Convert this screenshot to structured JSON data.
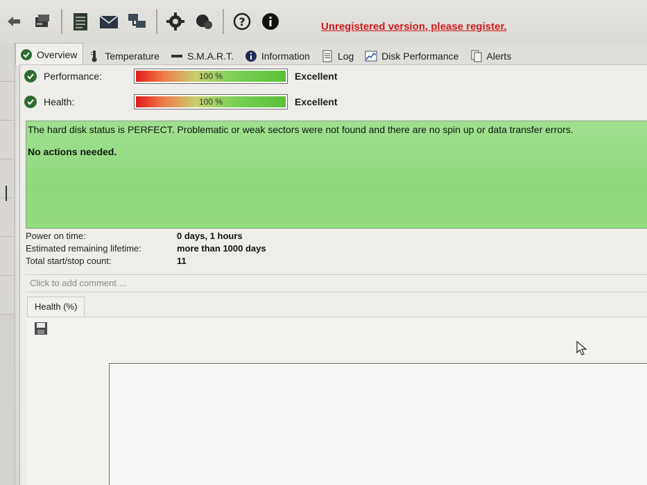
{
  "toolbar": {
    "items": [
      {
        "icon": "arrow-left-icon"
      },
      {
        "icon": "drive-icon"
      },
      {
        "icon": "notepad-icon"
      },
      {
        "icon": "email-icon"
      },
      {
        "icon": "network-icon"
      },
      {
        "icon": "settings-gear-icon"
      },
      {
        "icon": "tools-icon"
      },
      {
        "icon": "help-icon"
      },
      {
        "icon": "info-icon"
      }
    ],
    "register_link": "Unregistered version, please register."
  },
  "tabs": [
    {
      "label": "Overview",
      "icon": "check-icon",
      "active": true
    },
    {
      "label": "Temperature",
      "icon": "thermometer-icon",
      "active": false
    },
    {
      "label": "S.M.A.R.T.",
      "icon": "smart-icon",
      "active": false
    },
    {
      "label": "Information",
      "icon": "info-icon",
      "active": false
    },
    {
      "label": "Log",
      "icon": "log-icon",
      "active": false
    },
    {
      "label": "Disk Performance",
      "icon": "disk-performance-icon",
      "active": false
    },
    {
      "label": "Alerts",
      "icon": "alerts-icon",
      "active": false
    }
  ],
  "metrics": {
    "performance": {
      "label": "Performance:",
      "value": "100 %",
      "fraction": 1.0,
      "rating": "Excellent"
    },
    "health": {
      "label": "Health:",
      "value": "100 %",
      "fraction": 1.0,
      "rating": "Excellent"
    }
  },
  "status": {
    "line": "The hard disk status is PERFECT. Problematic or weak sectors were not found and there are no spin up or data transfer errors.",
    "action": "No actions needed."
  },
  "info": {
    "power_on_time": {
      "label": "Power on time:",
      "value": "0 days, 1 hours"
    },
    "remaining_lifetime": {
      "label": "Estimated remaining lifetime:",
      "value": "more than 1000 days"
    },
    "start_stop": {
      "label": "Total start/stop count:",
      "value": "11"
    }
  },
  "comment_placeholder": "Click to add comment ...",
  "health_chart": {
    "tab_label": "Health (%)"
  },
  "colors": {
    "status_green": "#94db80",
    "register_red": "#d11a1a",
    "check_green": "#2f6b2f"
  }
}
